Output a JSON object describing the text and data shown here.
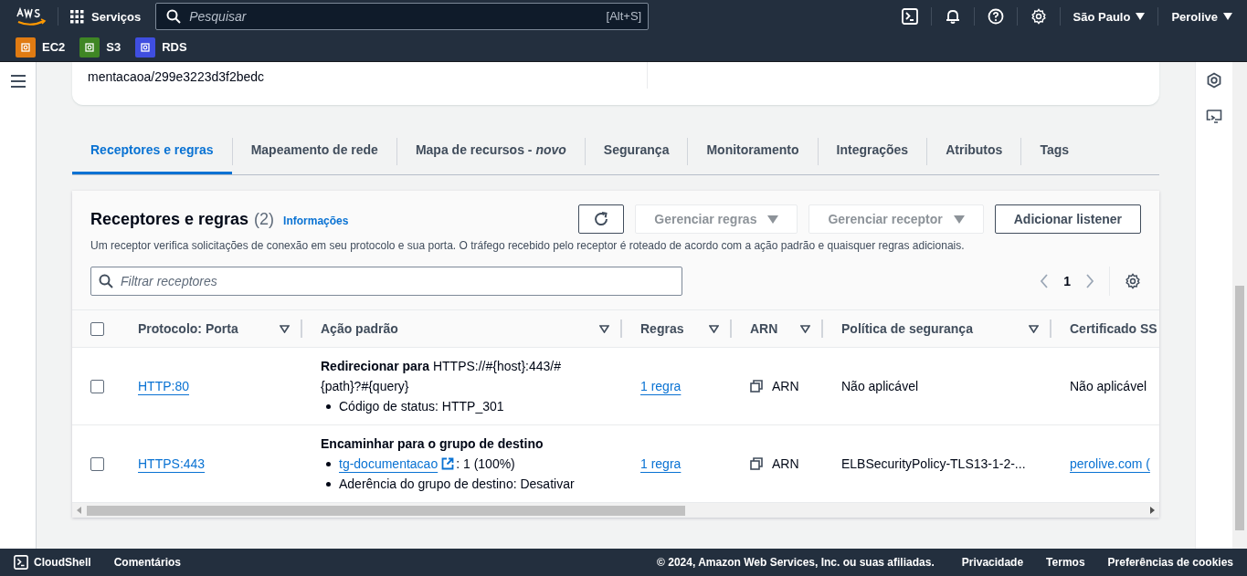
{
  "top_nav": {
    "services": "Serviços",
    "search": {
      "placeholder": "Pesquisar",
      "shortcut": "[Alt+S]"
    },
    "region": "São Paulo",
    "account": "Perolive"
  },
  "favorites": [
    {
      "label": "EC2",
      "color": "#e07b12"
    },
    {
      "label": "S3",
      "color": "#3f8624"
    },
    {
      "label": "RDS",
      "color": "#3f4ee0"
    }
  ],
  "detail_card": {
    "text": "mentacaoa/299e3223d3f2bedc"
  },
  "tabs": [
    {
      "label": "Receptores e regras",
      "selected": true
    },
    {
      "label": "Mapeamento de rede",
      "selected": false
    },
    {
      "label": "Mapa de recursos - *novo*",
      "selected": false
    },
    {
      "label": "Segurança",
      "selected": false
    },
    {
      "label": "Monitoramento",
      "selected": false
    },
    {
      "label": "Integrações",
      "selected": false
    },
    {
      "label": "Atributos",
      "selected": false
    },
    {
      "label": "Tags",
      "selected": false
    }
  ],
  "listeners": {
    "title": "Receptores e regras",
    "count": "(2)",
    "info": "Informações",
    "description": "Um receptor verifica solicitações de conexão em seu protocolo e sua porta. O tráfego recebido pelo receptor é roteado de acordo com a ação padrão e quaisquer regras adicionais.",
    "buttons": [
      {
        "label": "Gerenciar regras",
        "kind": "dropdown",
        "disabled": true
      },
      {
        "label": "Gerenciar receptor",
        "kind": "dropdown",
        "disabled": true
      },
      {
        "label": "Adicionar listener",
        "kind": "plain",
        "disabled": false
      }
    ],
    "filter": {
      "placeholder": "Filtrar receptores"
    },
    "page": "1",
    "select_all": {
      "checked": false
    },
    "columns": [
      {
        "label": "Protocolo: Porta",
        "sortable": true
      },
      {
        "label": "Ação padrão",
        "sortable": true
      },
      {
        "label": "Regras",
        "sortable": true
      },
      {
        "label": "ARN",
        "sortable": true
      },
      {
        "label": "Política de segurança",
        "sortable": true
      },
      {
        "label": "Certificado SS",
        "sortable": false
      }
    ],
    "rows": [
      {
        "checked": false,
        "protocol": "HTTP:80",
        "action_title": "Redirecionar para",
        "action_target": "HTTPS://#{host}:443/#{path}?#{query}",
        "bullets": [
          {
            "kind": "text",
            "text": "Código de status: HTTP_301"
          }
        ],
        "rules": "1 regra",
        "arn": "ARN",
        "policy": "Não aplicável",
        "certificate": {
          "kind": "text",
          "text": "Não aplicável"
        }
      },
      {
        "checked": false,
        "protocol": "HTTPS:443",
        "action_title": "Encaminhar para o grupo de destino",
        "bullets": [
          {
            "kind": "link",
            "link": "tg-documentacao",
            "text": ": 1 (100%)"
          },
          {
            "kind": "text",
            "text": "Aderência do grupo de destino: Desativar"
          }
        ],
        "rules": "1 regra",
        "arn": "ARN",
        "policy": "ELBSecurityPolicy-TLS13-1-2-...",
        "certificate": {
          "kind": "link",
          "text": "perolive.com ("
        }
      }
    ]
  },
  "footer": {
    "cloudshell": "CloudShell",
    "feedback": "Comentários",
    "copyright": "© 2024, Amazon Web Services, Inc. ou suas afiliadas.",
    "links": [
      "Privacidade",
      "Termos",
      "Preferências de cookies"
    ]
  }
}
